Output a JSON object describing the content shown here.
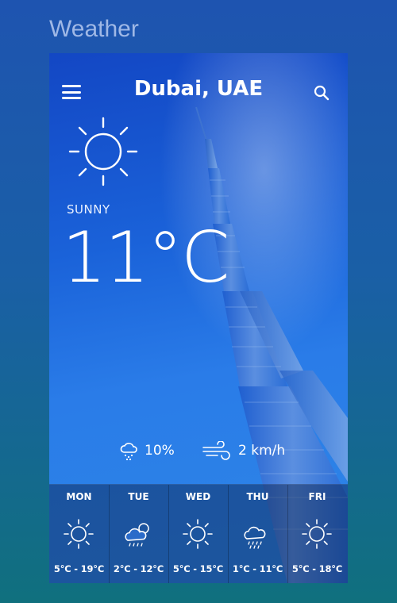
{
  "page_heading": "Weather",
  "header": {
    "city": "Dubai, UAE"
  },
  "current": {
    "condition": "SUNNY",
    "temperature": "11°C",
    "precipitation": "10%",
    "wind": "2 km/h"
  },
  "icons": {
    "menu": "hamburger-icon",
    "search": "search-icon",
    "main": "sun-icon",
    "precipitation": "rain-cloud-icon",
    "wind": "wind-icon"
  },
  "forecast": [
    {
      "day": "MON",
      "icon": "sun",
      "range": "5°C - 19°C"
    },
    {
      "day": "TUE",
      "icon": "cloud-rain",
      "range": "2°C - 12°C"
    },
    {
      "day": "WED",
      "icon": "sun",
      "range": "5°C - 15°C"
    },
    {
      "day": "THU",
      "icon": "cloud-rain",
      "range": "1°C - 11°C"
    },
    {
      "day": "FRI",
      "icon": "sun",
      "range": "5°C - 18°C"
    }
  ],
  "colors": {
    "background_top": "#1e54b0",
    "background_bottom": "#10707e",
    "card_top": "#1347c4",
    "text": "#ffffff"
  }
}
